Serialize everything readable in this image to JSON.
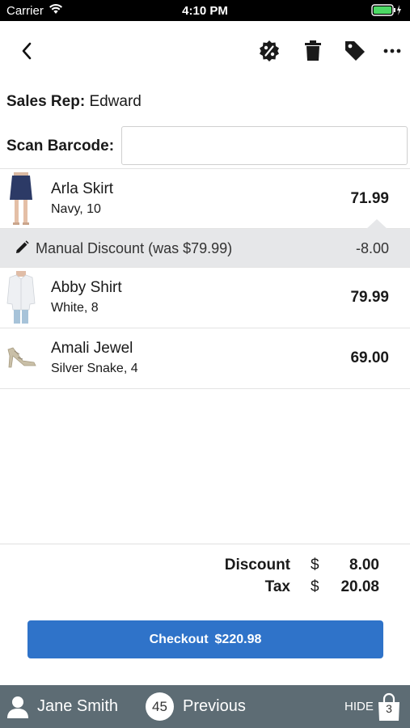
{
  "status_bar": {
    "carrier": "Carrier",
    "time": "4:10 PM"
  },
  "toolbar": {
    "back_icon": "chevron-left-icon",
    "discount_icon": "percent-badge-icon",
    "delete_icon": "trash-icon",
    "tag_icon": "tag-icon",
    "more_icon": "more-horizontal-icon"
  },
  "sales_rep": {
    "label": "Sales Rep:",
    "value": "Edward"
  },
  "scan": {
    "label": "Scan Barcode:",
    "placeholder": ""
  },
  "items": [
    {
      "name": "Arla Skirt",
      "variant": "Navy, 10",
      "price": "71.99"
    },
    {
      "name": "Abby Shirt",
      "variant": "White, 8",
      "price": "79.99"
    },
    {
      "name": "Amali Jewel",
      "variant": "Silver Snake, 4",
      "price": "69.00"
    }
  ],
  "discount": {
    "text": "Manual Discount (was $79.99)",
    "amount": "-8.00"
  },
  "totals": {
    "discount_label": "Discount",
    "discount_currency": "$",
    "discount_value": "8.00",
    "tax_label": "Tax",
    "tax_currency": "$",
    "tax_value": "20.08"
  },
  "checkout": {
    "label": "Checkout",
    "amount": "$220.98"
  },
  "bottom_bar": {
    "customer": "Jane Smith",
    "count": "45",
    "previous": "Previous",
    "hide": "HIDE",
    "bag_count": "3"
  },
  "colors": {
    "accent": "#2f73c9",
    "bottom_bar": "#5d6c74",
    "discount_bg": "#e6e7e9"
  }
}
